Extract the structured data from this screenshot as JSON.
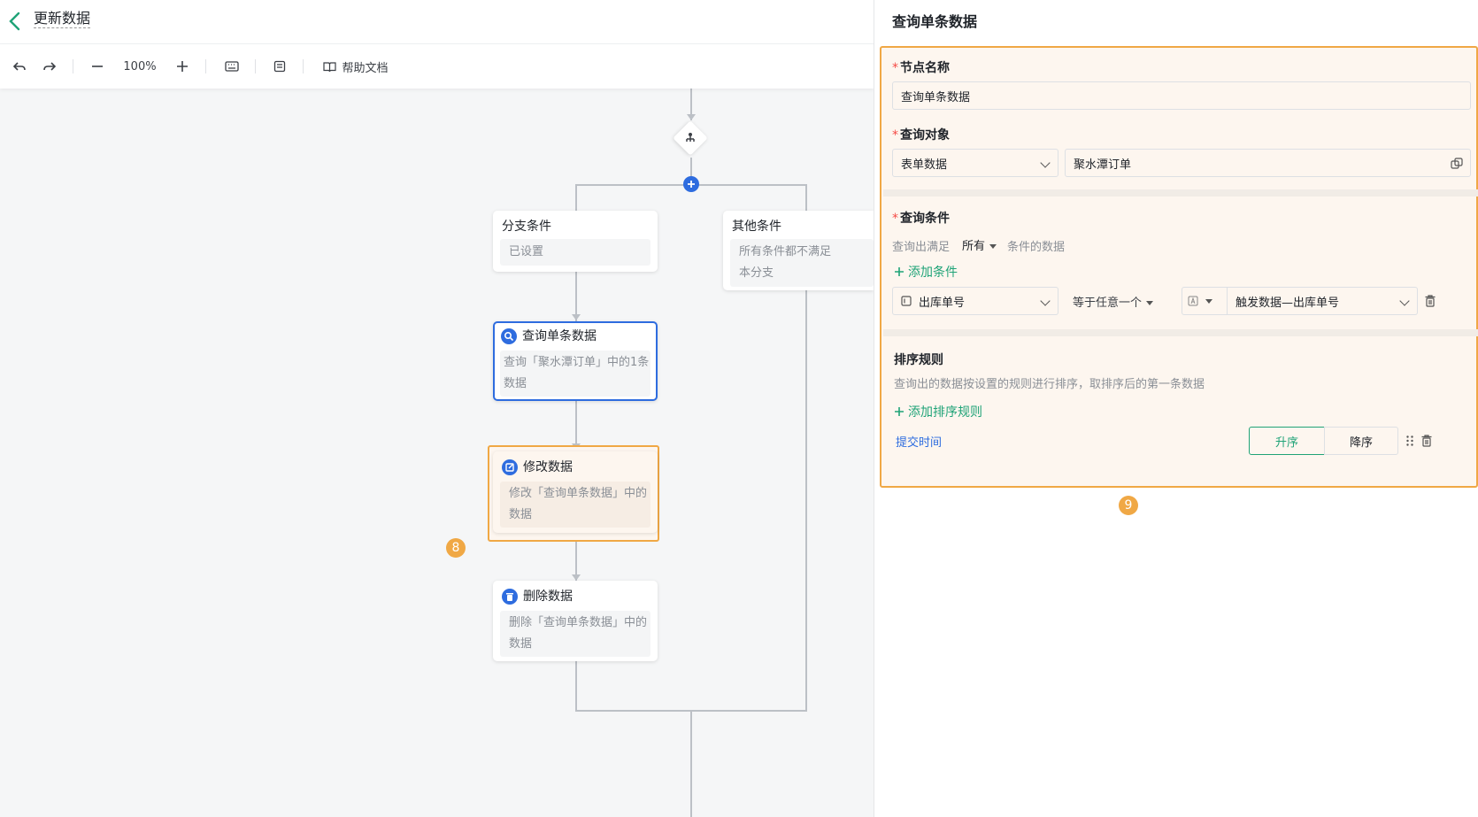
{
  "header": {
    "title": "更新数据"
  },
  "toolbar": {
    "zoom": "100%",
    "help_label": "帮助文档"
  },
  "flow": {
    "branch_condition": {
      "title": "分支条件",
      "body": "已设置"
    },
    "other_condition": {
      "title": "其他条件",
      "body_line1": "所有条件都不满足",
      "body_line2": "本分支"
    },
    "query_node": {
      "title": "查询单条数据",
      "body_line1": "查询「聚水潭订单」中的1条",
      "body_line2": "数据"
    },
    "modify_node": {
      "title": "修改数据",
      "body_line1": "修改「查询单条数据」中的",
      "body_line2": "数据"
    },
    "delete_node": {
      "title": "删除数据",
      "body_line1": "删除「查询单条数据」中的",
      "body_line2": "数据"
    },
    "badge_left": "8"
  },
  "panel": {
    "title": "查询单条数据",
    "node_name": {
      "label": "节点名称",
      "value": "查询单条数据"
    },
    "query_object": {
      "label": "查询对象",
      "type_value": "表单数据",
      "form_value": "聚水潭订单"
    },
    "query_condition": {
      "label": "查询条件",
      "prefix": "查询出满足",
      "match_mode": "所有",
      "suffix": "条件的数据",
      "add_label": "添加条件",
      "field": "出库单号",
      "operator": "等于任意一个",
      "value": "触发数据—出库单号"
    },
    "sort_rule": {
      "label": "排序规则",
      "desc": "查询出的数据按设置的规则进行排序，取排序后的第一条数据",
      "add_label": "添加排序规则",
      "field": "提交时间",
      "asc_label": "升序",
      "desc_label": "降序"
    },
    "badge": "9"
  },
  "colors": {
    "accent": "#1fa377",
    "highlight": "#f0a845",
    "node_blue": "#2e6cdf"
  }
}
